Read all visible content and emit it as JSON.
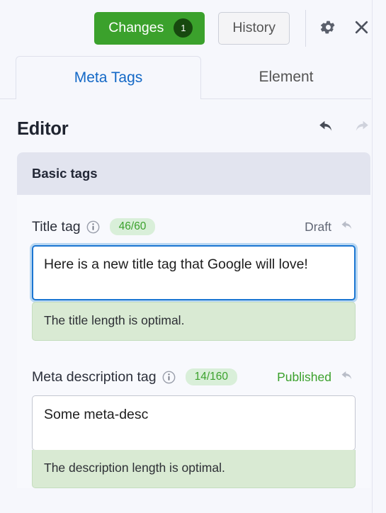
{
  "toolbar": {
    "changes_label": "Changes",
    "changes_count": "1",
    "history_label": "History",
    "settings_icon": "gear-icon",
    "close_icon": "close-icon",
    "accent_green": "#3ba12c",
    "badge_dark_green": "#17490f"
  },
  "tabs": [
    {
      "label": "Meta Tags",
      "active": true,
      "color": "#1368c6"
    },
    {
      "label": "Element",
      "active": false,
      "color": "#545454"
    }
  ],
  "editor": {
    "title": "Editor",
    "undo_icon": "undo-icon",
    "redo_icon": "redo-icon",
    "undo_enabled": true,
    "redo_enabled": false
  },
  "card": {
    "header": "Basic tags",
    "fields": [
      {
        "label": "Title tag",
        "info_icon": "info-icon",
        "counter": "46/60",
        "status": "Draft",
        "status_color": "#616775",
        "revert_icon": "revert-icon",
        "value": "Here is a new title tag that Google will love!",
        "focused": true,
        "hint": "The title length is optimal.",
        "hint_color": "#d9ead3"
      },
      {
        "label": "Meta description tag",
        "info_icon": "info-icon",
        "counter": "14/160",
        "status": "Published",
        "status_color": "#3ba12c",
        "revert_icon": "revert-icon",
        "value": "Some meta-desc",
        "focused": false,
        "hint": "The description length is optimal.",
        "hint_color": "#d9ead3"
      }
    ]
  }
}
